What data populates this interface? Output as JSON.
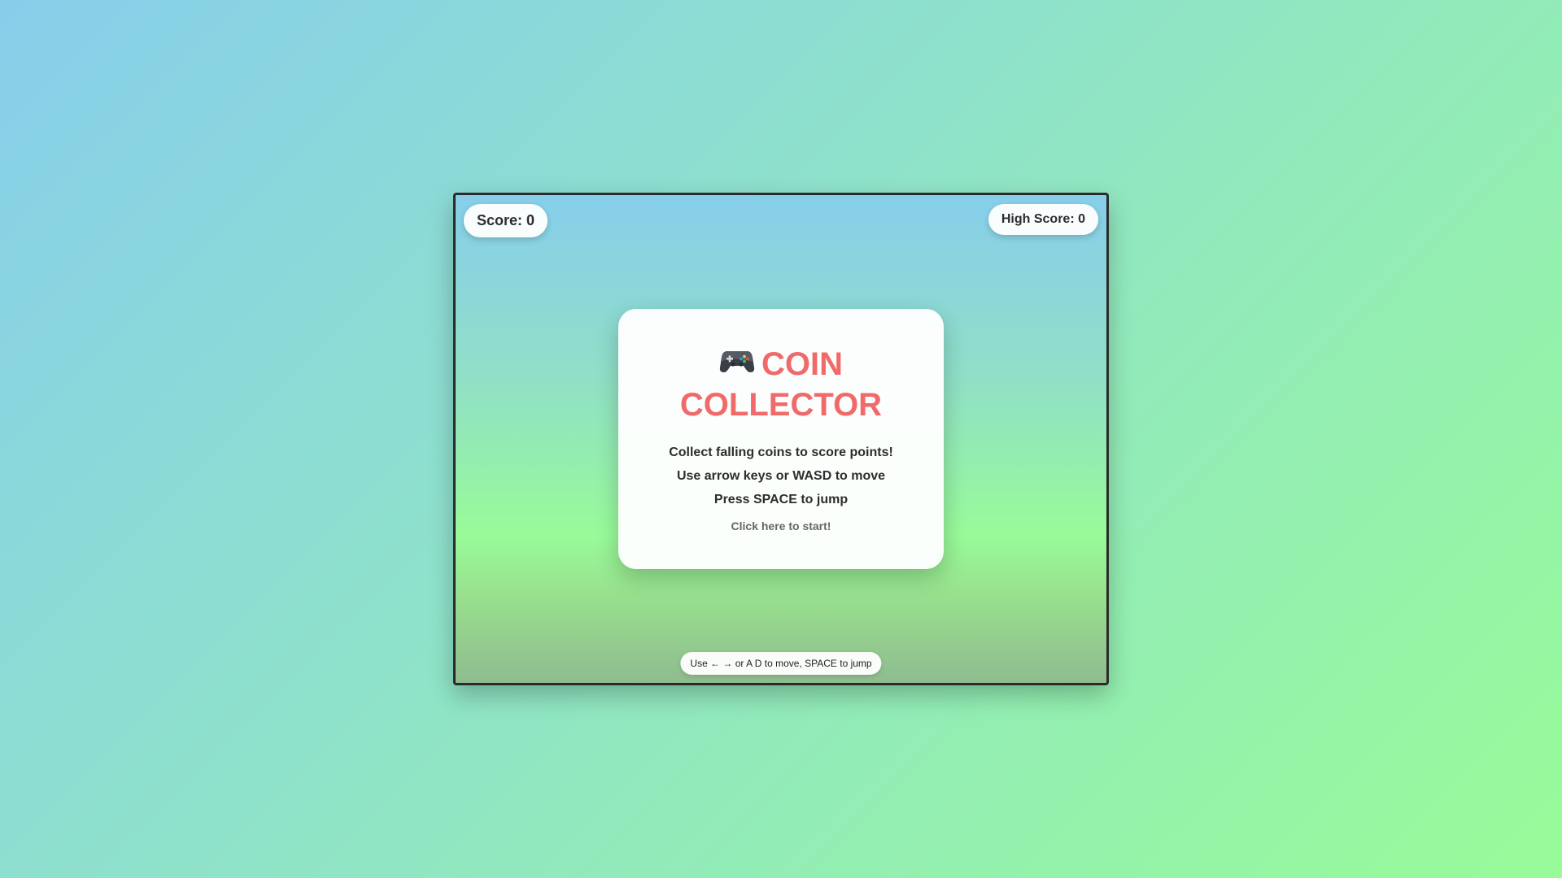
{
  "hud": {
    "score_label": "Score: 0",
    "high_score_label": "High Score: 0"
  },
  "menu": {
    "icon": "gamepad-icon",
    "title": "COIN COLLECTOR",
    "instructions": [
      "Collect falling coins to score points!",
      "Use arrow keys or WASD to move",
      "Press SPACE to jump"
    ],
    "start_prompt": "Click here to start!"
  },
  "controls_hint": "Use ← → or A D to move, SPACE to jump",
  "colors": {
    "title": "#f06a6a",
    "sky_top": "#87ceeb",
    "grass": "#98fb98",
    "ground": "#8fbc8f",
    "frame_border": "#2b2b2b"
  }
}
